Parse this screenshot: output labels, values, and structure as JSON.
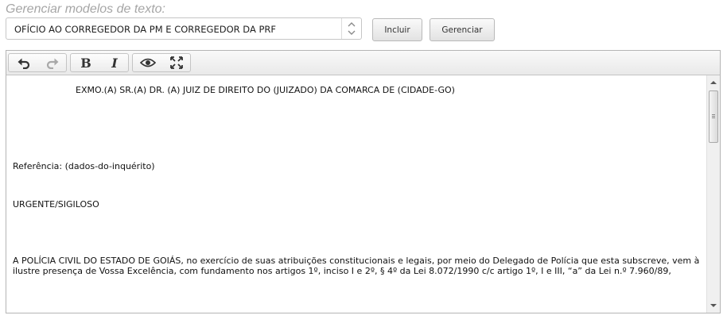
{
  "section": {
    "title": "Gerenciar modelos de texto:"
  },
  "model_select": {
    "selected": "OFÍCIO AO CORREGEDOR DA PM E CORREGEDOR DA PRF"
  },
  "buttons": {
    "include_label": "Incluir",
    "manage_label": "Gerenciar"
  },
  "toolbar": {
    "items": [
      "undo-icon",
      "redo-icon",
      "bold",
      "italic",
      "eye-icon",
      "fullscreen-icon"
    ],
    "bold_label": "B",
    "italic_label": "I"
  },
  "document": {
    "addressee": "EXMO.(A) SR.(A) DR. (A) JUIZ DE DIREITO DO (JUIZADO) DA COMARCA DE (CIDADE-GO)",
    "reference": "Referência: (dados-do-inquérito)",
    "urgency": "URGENTE/SIGILOSO",
    "body": "A POLÍCIA CIVIL DO ESTADO DE GOIÁS, no exercício de suas atribuições constitucionais e legais, por meio do Delegado de Polícia que esta subscreve, vem à ilustre presença de Vossa Excelência, com fundamento nos artigos 1º, inciso I e 2º, § 4º da Lei 8.072/1990 c/c artigo 1º, I e III, “a” da Lei n.º 7.960/89,"
  },
  "colors": {
    "title_gray": "#a6a6a6",
    "border": "#b5b5b5",
    "text": "#111111"
  }
}
